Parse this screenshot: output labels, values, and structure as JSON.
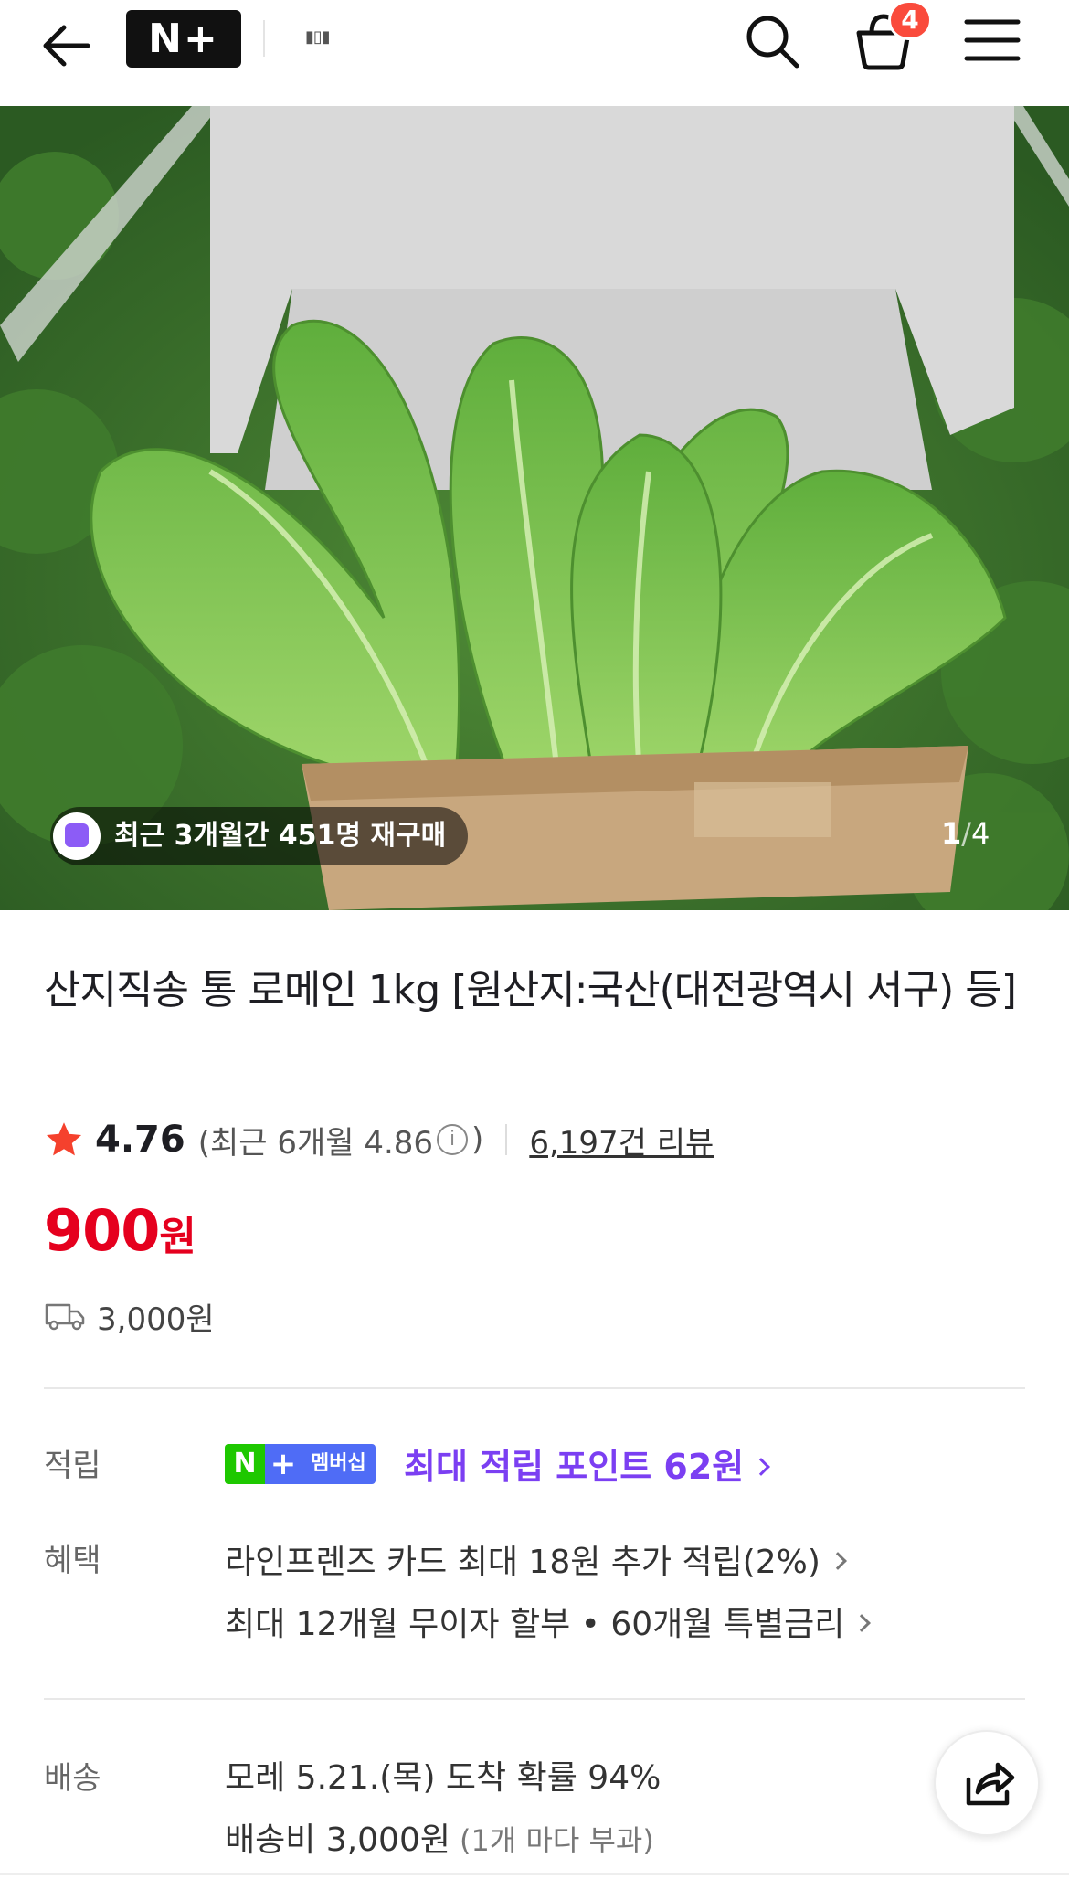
{
  "header": {
    "back_icon": "arrow-left-icon",
    "logo_text": "N+",
    "search_icon": "search-icon",
    "cart_icon": "shopping-basket-icon",
    "cart_count": "4",
    "menu_icon": "hamburger-menu-icon"
  },
  "hero": {
    "image_alt": "romaine-lettuce-box-photo",
    "repurchase_icon": "shopping-bag-icon",
    "repurchase_text": "최근 3개월간 451명 재구매",
    "page_current": "1",
    "page_separator": "/",
    "page_total": "4"
  },
  "product": {
    "title": "산지직송 통 로메인 1kg [원산지:국산(대전광역시 서구) 등]",
    "rating": "4.76",
    "rating_recent_prefix": "(최근 6개월 4.86",
    "rating_recent_suffix": ")",
    "review_count_text": "6,197건 리뷰",
    "price_value": "900",
    "price_unit": "원",
    "shipping_fee": "3,000원"
  },
  "benefits": {
    "points_label": "적립",
    "membership_badge_n": "N",
    "membership_badge_plus": "+",
    "membership_badge_text": "멤버십",
    "points_text": "최대 적립 포인트 62원",
    "benefit_label": "혜택",
    "benefit_card": "라인프렌즈 카드 최대 18원 추가 적립(2%)",
    "benefit_installment": "최대 12개월 무이자 할부 • 60개월 특별금리"
  },
  "delivery": {
    "label": "배송",
    "arrival": "모레 5.21.(목) 도착 확률 94%",
    "fee": "배송비 3,000원",
    "fee_note": "(1개 마다 부과)"
  },
  "colors": {
    "price_red": "#e5001e",
    "membership_purple": "#7b3ff2",
    "naver_green": "#1ec800",
    "badge_red": "#fa4b3c",
    "star_red": "#f5412d"
  }
}
